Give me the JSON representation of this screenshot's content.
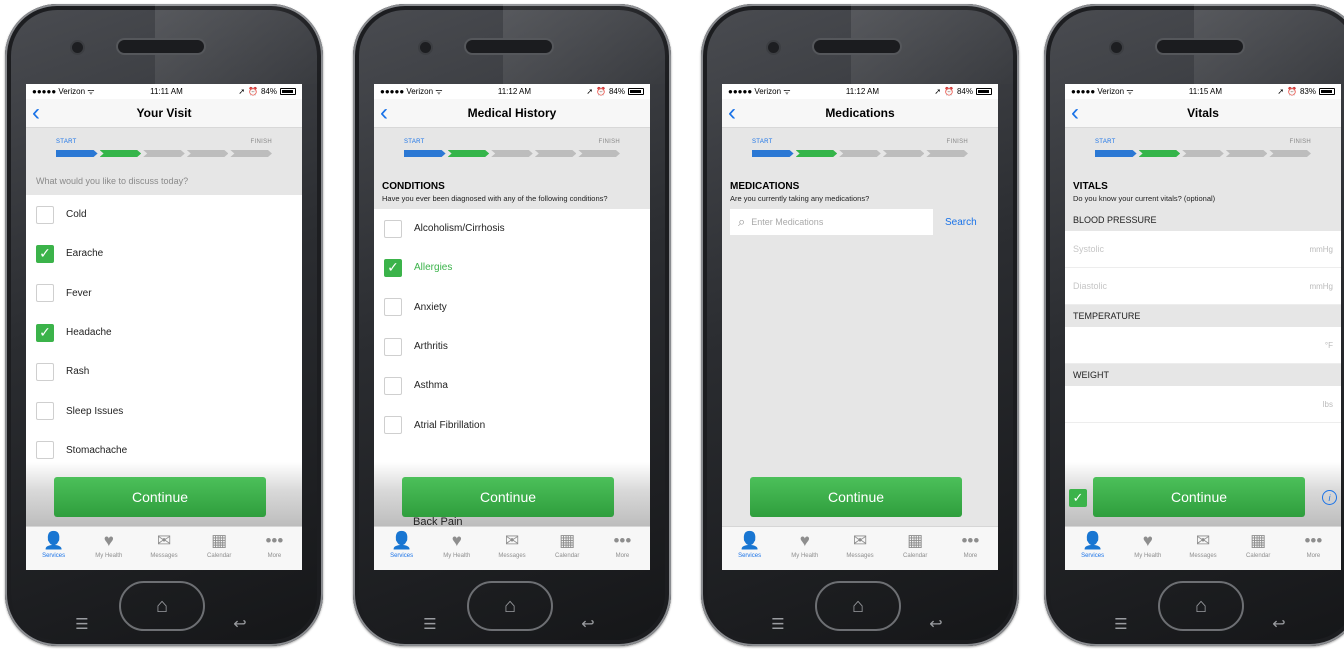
{
  "status": {
    "carrier": "●●●●● Verizon ᯤ"
  },
  "tab_bar": [
    {
      "label": "Services",
      "icon": "person-icon"
    },
    {
      "label": "My Health",
      "icon": "heart-icon"
    },
    {
      "label": "Messages",
      "icon": "envelope-icon"
    },
    {
      "label": "Calendar",
      "icon": "calendar-icon"
    },
    {
      "label": "More",
      "icon": "more-dots-icon"
    }
  ],
  "continue_label": "Continue",
  "progress": {
    "start": "START",
    "finish": "FINISH"
  },
  "phones": [
    {
      "time": "11:11 AM",
      "battery": "84%",
      "title": "Your Visit",
      "prompt": "What would you like to discuss today?",
      "items": [
        {
          "label": "Cold",
          "checked": false
        },
        {
          "label": "Earache",
          "checked": true
        },
        {
          "label": "Fever",
          "checked": false
        },
        {
          "label": "Headache",
          "checked": true
        },
        {
          "label": "Rash",
          "checked": false
        },
        {
          "label": "Sleep Issues",
          "checked": false
        },
        {
          "label": "Stomachache",
          "checked": false
        }
      ]
    },
    {
      "time": "11:12 AM",
      "battery": "84%",
      "title": "Medical History",
      "section_title": "CONDITIONS",
      "section_sub": "Have you ever been diagnosed with any of the following conditions?",
      "items": [
        {
          "label": "Alcoholism/Cirrhosis",
          "checked": false
        },
        {
          "label": "Allergies",
          "checked": true
        },
        {
          "label": "Anxiety",
          "checked": false
        },
        {
          "label": "Arthritis",
          "checked": false
        },
        {
          "label": "Asthma",
          "checked": false
        },
        {
          "label": "Atrial Fibrillation",
          "checked": false
        }
      ],
      "partial_item": "Back Pain"
    },
    {
      "time": "11:12 AM",
      "battery": "84%",
      "title": "Medications",
      "section_title": "MEDICATIONS",
      "section_sub": "Are you currently taking any medications?",
      "search_placeholder": "Enter Medications",
      "search_label": "Search"
    },
    {
      "time": "11:15 AM",
      "battery": "83%",
      "title": "Vitals",
      "section_title": "VITALS",
      "section_sub": "Do you know your current vitals? (optional)",
      "blood_pressure": "BLOOD PRESSURE",
      "systolic": "Systolic",
      "diastolic": "Diastolic",
      "mmhg": "mmHg",
      "temperature": "TEMPERATURE",
      "temp_unit": "°F",
      "weight": "WEIGHT",
      "weight_unit": "lbs"
    }
  ]
}
